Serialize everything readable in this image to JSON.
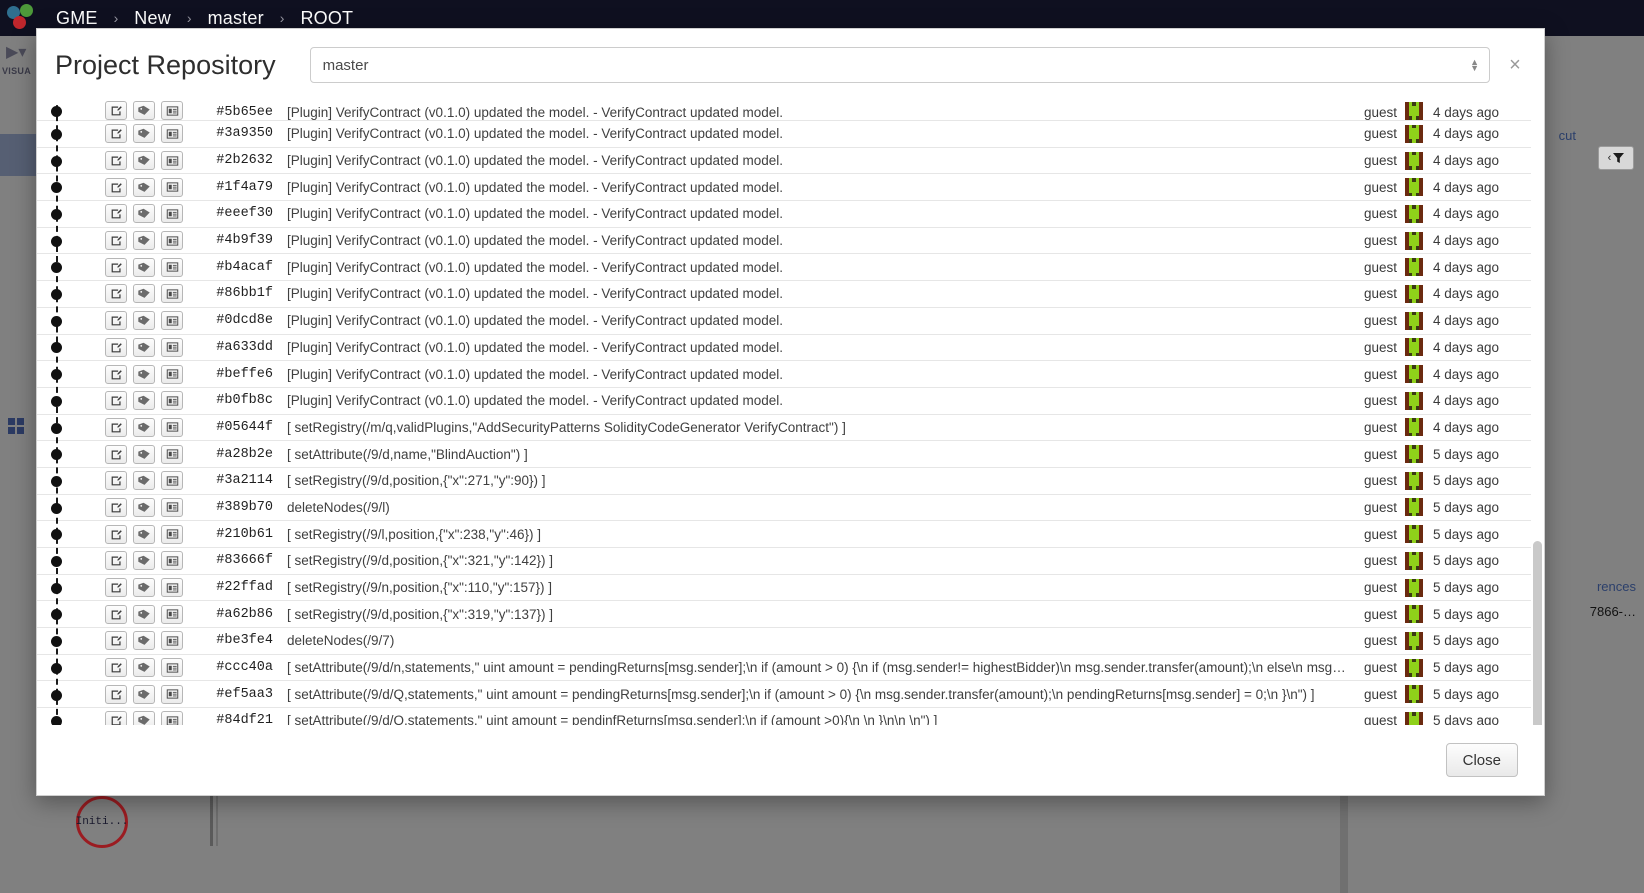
{
  "topbar": {
    "logo_name": "gme-logo",
    "breadcrumbs": [
      "GME",
      "New",
      "master",
      "ROOT"
    ],
    "separator": "›"
  },
  "background": {
    "rail": {
      "play_label": "▶",
      "caret": "▾",
      "section_label": "VISUA"
    },
    "node_label": "Initi...",
    "cut_label": "cut",
    "filter_label": "‹",
    "references_label": "rences",
    "hash_label": "7866-…"
  },
  "modal": {
    "title": "Project Repository",
    "branch_value": "master",
    "branch_placeholder": "master",
    "close_icon_label": "×",
    "close_button_label": "Close",
    "columns": [
      "actions",
      "hash",
      "message",
      "user",
      "avatar",
      "time"
    ],
    "row_buttons": [
      {
        "name": "edit-commit-icon",
        "title": "Edit"
      },
      {
        "name": "tag-commit-icon",
        "title": "Tag"
      },
      {
        "name": "info-commit-icon",
        "title": "Details"
      }
    ],
    "commits": [
      {
        "hash": "#5b65ee",
        "message": "[Plugin] VerifyContract (v0.1.0) updated the model. - VerifyContract updated model.",
        "user": "guest",
        "time": "4 days ago",
        "partial": true
      },
      {
        "hash": "#3a9350",
        "message": "[Plugin] VerifyContract (v0.1.0) updated the model. - VerifyContract updated model.",
        "user": "guest",
        "time": "4 days ago"
      },
      {
        "hash": "#2b2632",
        "message": "[Plugin] VerifyContract (v0.1.0) updated the model. - VerifyContract updated model.",
        "user": "guest",
        "time": "4 days ago"
      },
      {
        "hash": "#1f4a79",
        "message": "[Plugin] VerifyContract (v0.1.0) updated the model. - VerifyContract updated model.",
        "user": "guest",
        "time": "4 days ago"
      },
      {
        "hash": "#eeef30",
        "message": "[Plugin] VerifyContract (v0.1.0) updated the model. - VerifyContract updated model.",
        "user": "guest",
        "time": "4 days ago"
      },
      {
        "hash": "#4b9f39",
        "message": "[Plugin] VerifyContract (v0.1.0) updated the model. - VerifyContract updated model.",
        "user": "guest",
        "time": "4 days ago"
      },
      {
        "hash": "#b4acaf",
        "message": "[Plugin] VerifyContract (v0.1.0) updated the model. - VerifyContract updated model.",
        "user": "guest",
        "time": "4 days ago"
      },
      {
        "hash": "#86bb1f",
        "message": "[Plugin] VerifyContract (v0.1.0) updated the model. - VerifyContract updated model.",
        "user": "guest",
        "time": "4 days ago"
      },
      {
        "hash": "#0dcd8e",
        "message": "[Plugin] VerifyContract (v0.1.0) updated the model. - VerifyContract updated model.",
        "user": "guest",
        "time": "4 days ago"
      },
      {
        "hash": "#a633dd",
        "message": "[Plugin] VerifyContract (v0.1.0) updated the model. - VerifyContract updated model.",
        "user": "guest",
        "time": "4 days ago"
      },
      {
        "hash": "#beffe6",
        "message": "[Plugin] VerifyContract (v0.1.0) updated the model. - VerifyContract updated model.",
        "user": "guest",
        "time": "4 days ago"
      },
      {
        "hash": "#b0fb8c",
        "message": "[Plugin] VerifyContract (v0.1.0) updated the model. - VerifyContract updated model.",
        "user": "guest",
        "time": "4 days ago"
      },
      {
        "hash": "#05644f",
        "message": "[ setRegistry(/m/q,validPlugins,\"AddSecurityPatterns SolidityCodeGenerator VerifyContract\") ]",
        "user": "guest",
        "time": "4 days ago"
      },
      {
        "hash": "#a28b2e",
        "message": "[ setAttribute(/9/d,name,\"BlindAuction\") ]",
        "user": "guest",
        "time": "5 days ago"
      },
      {
        "hash": "#3a2114",
        "message": "[ setRegistry(/9/d,position,{\"x\":271,\"y\":90}) ]",
        "user": "guest",
        "time": "5 days ago"
      },
      {
        "hash": "#389b70",
        "message": "deleteNodes(/9/l)",
        "user": "guest",
        "time": "5 days ago"
      },
      {
        "hash": "#210b61",
        "message": "[ setRegistry(/9/l,position,{\"x\":238,\"y\":46}) ]",
        "user": "guest",
        "time": "5 days ago"
      },
      {
        "hash": "#83666f",
        "message": "[ setRegistry(/9/d,position,{\"x\":321,\"y\":142}) ]",
        "user": "guest",
        "time": "5 days ago"
      },
      {
        "hash": "#22ffad",
        "message": "[ setRegistry(/9/n,position,{\"x\":110,\"y\":157}) ]",
        "user": "guest",
        "time": "5 days ago"
      },
      {
        "hash": "#a62b86",
        "message": "[ setRegistry(/9/d,position,{\"x\":319,\"y\":137}) ]",
        "user": "guest",
        "time": "5 days ago"
      },
      {
        "hash": "#be3fe4",
        "message": "deleteNodes(/9/7)",
        "user": "guest",
        "time": "5 days ago"
      },
      {
        "hash": "#ccc40a",
        "message": "[ setAttribute(/9/d/n,statements,\" uint amount = pendingReturns[msg.sender];\\n if (amount > 0) {\\n if (msg.sender!= highestBidder)\\n msg.sender.transfer(amount);\\n else\\n msg…",
        "user": "guest",
        "time": "5 days ago"
      },
      {
        "hash": "#ef5aa3",
        "message": "[ setAttribute(/9/d/Q,statements,\" uint amount = pendingReturns[msg.sender];\\n if (amount > 0) {\\n msg.sender.transfer(amount);\\n pendingReturns[msg.sender] = 0;\\n }\\n\") ]",
        "user": "guest",
        "time": "5 days ago"
      },
      {
        "hash": "#84df21",
        "message": "[ setAttribute(/9/d/Q,statements,\" uint amount = pendinfReturns[msg.sender];\\n if (amount >0){\\n \\n }\\n\\n \\n\") ]",
        "user": "guest",
        "time": "5 days ago"
      }
    ]
  },
  "colors": {
    "topbar_bg": "#0f1020",
    "canvas_bg": "#808080",
    "accent_link": "#2b3f6b",
    "node_border": "#9b1c21",
    "avatar_dark": "#3b3a14",
    "avatar_bright": "#8fd11a",
    "avatar_red": "#6b2a10"
  }
}
